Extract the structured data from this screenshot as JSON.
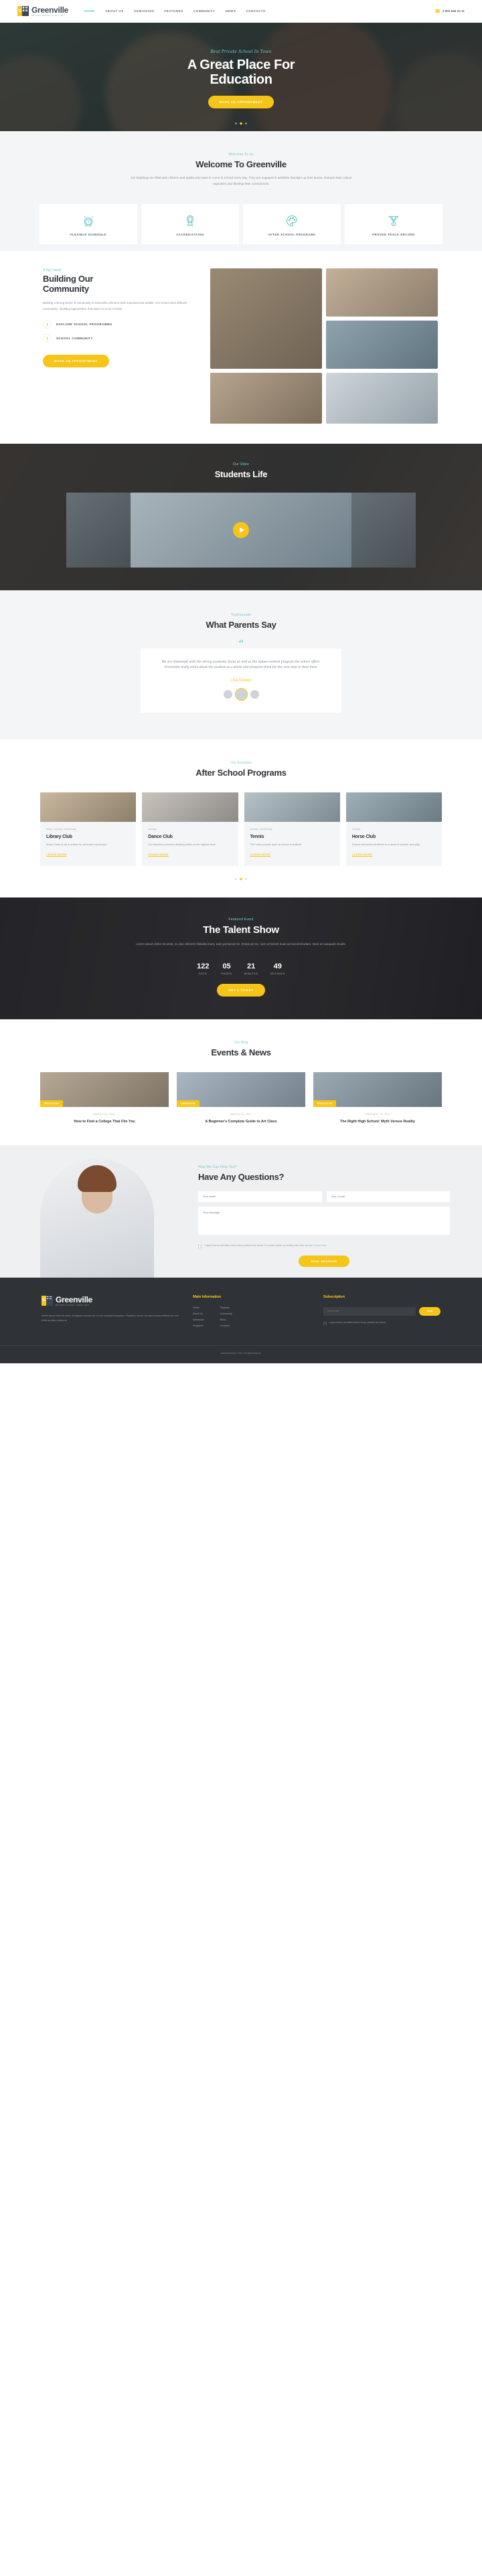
{
  "brand": {
    "name": "Greenville",
    "tagline": "PRIVATE SCHOOL SINCE 1975",
    "logo_letter": "G"
  },
  "colors": {
    "accent_yellow": "#f5c518",
    "accent_teal": "#5bbfc4",
    "dark": "#2f3338"
  },
  "header": {
    "nav": [
      {
        "label": "HOME",
        "active": true
      },
      {
        "label": "ABOUT US",
        "active": false
      },
      {
        "label": "ADMISSION",
        "active": false
      },
      {
        "label": "FEATURES",
        "active": false
      },
      {
        "label": "COMMUNITY",
        "active": false
      },
      {
        "label": "NEWS",
        "active": false
      },
      {
        "label": "CONTACTS",
        "active": false
      }
    ],
    "phone_icon": "phone-icon",
    "phone": "0 800 555 22 11"
  },
  "hero": {
    "eyebrow": "Best Private School In Town",
    "title_line1": "A Great Place For",
    "title_line2": "Education",
    "cta": "MAKE AN APPOINTMENT",
    "slides": 3,
    "active_slide": 1
  },
  "welcome": {
    "eyebrow": "Welcome To Us",
    "title": "Welcome To Greenville",
    "lead": "Our buildings are filled with children and adults who want to come to school every day. They are engaged in activities that light up their brains, sharpen their critical capacities and develop their consciences.",
    "features": [
      {
        "icon": "alarm-clock-icon",
        "label": "FLEXIBLE SCHEDULE"
      },
      {
        "icon": "award-ribbon-icon",
        "label": "ACCREDITATION"
      },
      {
        "icon": "paint-palette-icon",
        "label": "AFTER SCHOOL PROGRAMS"
      },
      {
        "icon": "medal-icon",
        "label": "PROVEN TRACK RECORD"
      }
    ]
  },
  "community": {
    "eyebrow": "A Big Family",
    "title_line1": "Building Our",
    "title_line2": "Community",
    "text": "Building a strong sense of community in Greenville school is both important and doable. Our school uses different Community - Building Approaches, that helps us to be a family.",
    "links": [
      {
        "label": "EXPLORE SCHOOL PROGRAMMS",
        "icon": "chevron-right-icon"
      },
      {
        "label": "SCHOOL COMMUNITY",
        "icon": "chevron-right-icon"
      }
    ],
    "cta": "MAKE AN APPOINTMENT",
    "gallery": [
      "community-photo-1",
      "community-photo-2",
      "community-photo-3",
      "community-photo-4"
    ]
  },
  "students": {
    "eyebrow": "Our Video",
    "title": "Students Life",
    "play_icon": "play-icon"
  },
  "testimonials": {
    "eyebrow": "Testimonials",
    "title": "What Parents Say",
    "quote_icon": "quote-icon",
    "quote": "We are impressed with the strong academic focus as well as the values-centred program the school offers. Greenville really cares about the student as a whole and prepares them for the next step in their lives.",
    "author": "Lisa Dowen",
    "avatars": 3,
    "active_avatar": 1
  },
  "programs": {
    "eyebrow": "Our Activities",
    "title": "After School Programs",
    "cards": [
      {
        "meta": "friday / monday / wednesday",
        "name": "Library Club",
        "desc": "Music Class is as a vehicle for personal expression.",
        "link": "LEARN MORE"
      },
      {
        "meta": "monday",
        "name": "Dance Club",
        "desc": "Our teachers provides drawing tuition at the highest level",
        "link": "LEARN MORE"
      },
      {
        "meta": "monday / wednesday",
        "name": "Tennis",
        "desc": "The most popular sport at school is football.",
        "link": "LEARN MORE"
      },
      {
        "meta": "monday",
        "name": "Horse Club",
        "desc": "Drama introduces students to a world of wonder and play.",
        "link": "LEARN MORE"
      }
    ],
    "dots": 3,
    "active_dot": 1
  },
  "talent": {
    "eyebrow": "Featured Event",
    "title": "The Talent Show",
    "lead": "Lorem ipsum dolor sit amet, cu duo dolorem fabulas iriure, eam persecuti ne. Oratio pri ne, cum ut harum suas ad accommodare. Nam at nusquam eruditi.",
    "countdown": [
      {
        "value": "122",
        "label": "DAYS"
      },
      {
        "value": "05",
        "label": "HOURS"
      },
      {
        "value": "21",
        "label": "MINUTES"
      },
      {
        "value": "49",
        "label": "SECONDS"
      }
    ],
    "cta": "GET A TICKET"
  },
  "blog": {
    "eyebrow": "Our Blog",
    "title": "Events & News",
    "posts": [
      {
        "badge": "EDUCATION",
        "date": "MARCH 13, 2017",
        "title": "How to Find a College That Fits You"
      },
      {
        "badge": "ADMISSION",
        "date": "MARCH 13, 2017",
        "title": "A Beginner's Complete Guide to Art Class"
      },
      {
        "badge": "EDUCATION",
        "date": "FEBRUARY 19, 2017",
        "title": "The Right High School: Myth Versus Reality"
      }
    ]
  },
  "questions": {
    "eyebrow": "How We Can Help You?",
    "title": "Have Any Questions?",
    "fields": [
      {
        "name": "name-field",
        "placeholder": "Your name"
      },
      {
        "name": "email-field",
        "placeholder": "Your e-mail"
      }
    ],
    "message_placeholder": "Your message",
    "consent_text": "I agree that my submitted data is being collected and stored. For further details on handling user data, see our ",
    "consent_link": "Privacy Policy",
    "send_label": "SEND MESSAGE"
  },
  "footer": {
    "about": "Lorem ipsum dolor sit amet, at aliquam doctus mel, te eos nominavi torquatos. Phasellus rutrum vel amet doctus eleifend ad cum. Nulla ancillae civibus at.",
    "main_heading": "Main Information",
    "links_col1": [
      "Home",
      "About Us",
      "Admission",
      "Programs"
    ],
    "links_col2": [
      "Features",
      "Community",
      "News",
      "Contacts"
    ],
    "subscription_heading": "Subscription",
    "subscribe_placeholder": "Your e-mail",
    "subscribe_button": "Send",
    "subscribe_consent": "I agree that my submitted data is being collected and stored.",
    "copyright": "AncoraThemes © 2019. All rights reserved."
  }
}
